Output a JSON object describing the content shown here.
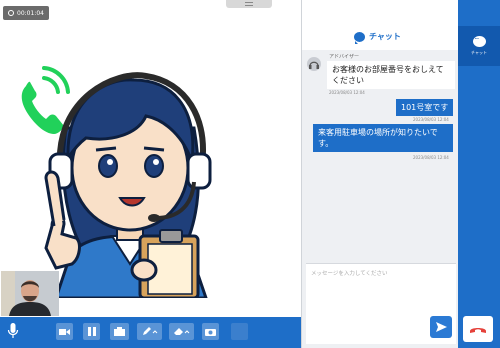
{
  "call": {
    "timer": "00:01:04"
  },
  "chat": {
    "title": "チャット",
    "messages": [
      {
        "dir": "in",
        "sender": "アドバイザー",
        "text": "お客様のお部屋番号をおしえてください",
        "time": "2023/08/03 12:04"
      },
      {
        "dir": "out",
        "text": "101号室です",
        "time": "2023/08/03 12:04"
      },
      {
        "dir": "out",
        "text": "来客用駐車場の場所が知りたいです。",
        "time": "2023/08/03 12:04"
      }
    ],
    "input_placeholder": "メッセージを入力してください"
  },
  "rail": {
    "chat_label": "チャット"
  },
  "colors": {
    "primary": "#1e6ec8",
    "accent_green": "#21d15a",
    "hangup_red": "#e5413a"
  },
  "icons": [
    "clock-icon",
    "phone-ringing-icon",
    "mic-icon",
    "video-icon",
    "pause-icon",
    "share-icon",
    "pen-icon",
    "eraser-icon",
    "camera-icon",
    "chat-icon",
    "send-icon",
    "hangup-icon"
  ]
}
